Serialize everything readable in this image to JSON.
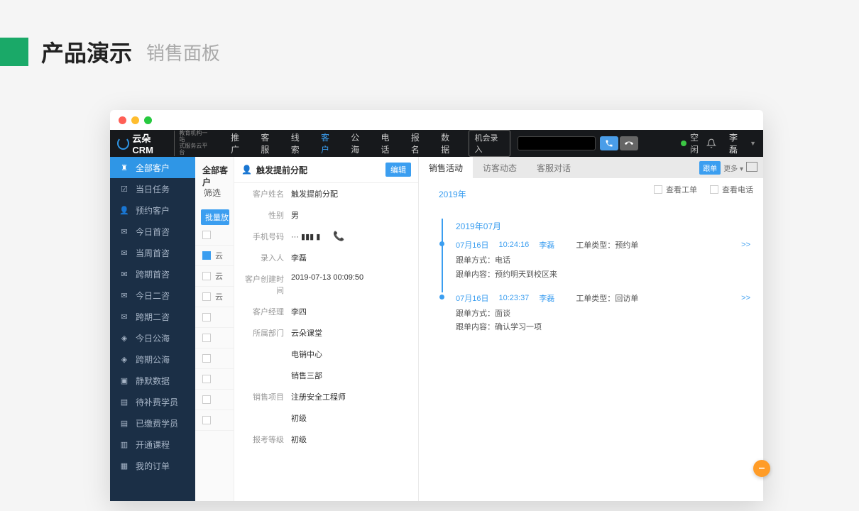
{
  "page": {
    "title": "产品演示",
    "subtitle": "销售面板"
  },
  "topbar": {
    "logo_text": "云朵CRM",
    "logo_sub1": "教育机构一站",
    "logo_sub2": "式服务云平台",
    "nav": [
      "推广",
      "客服",
      "线索",
      "客户",
      "公海",
      "电话",
      "报名",
      "数据"
    ],
    "nav_active_index": 3,
    "entry_button": "机会录入",
    "status_label": "空闲",
    "user": "李磊"
  },
  "sidebar": {
    "items": [
      {
        "label": "全部客户",
        "icon": "user"
      },
      {
        "label": "当日任务",
        "icon": "check"
      },
      {
        "label": "预约客户",
        "icon": "user"
      },
      {
        "label": "今日首咨",
        "icon": "chat"
      },
      {
        "label": "当周首咨",
        "icon": "chat"
      },
      {
        "label": "跨期首咨",
        "icon": "chat"
      },
      {
        "label": "今日二咨",
        "icon": "chat"
      },
      {
        "label": "跨期二咨",
        "icon": "chat"
      },
      {
        "label": "今日公海",
        "icon": "sea"
      },
      {
        "label": "跨期公海",
        "icon": "sea"
      },
      {
        "label": "静默数据",
        "icon": "data"
      },
      {
        "label": "待补费学员",
        "icon": "money"
      },
      {
        "label": "已缴费学员",
        "icon": "money"
      },
      {
        "label": "开通课程",
        "icon": "book"
      },
      {
        "label": "我的订单",
        "icon": "order"
      }
    ],
    "active_index": 0
  },
  "midcol": {
    "header": "全部客户",
    "filter": "筛选",
    "batch": "批量放",
    "rows": [
      {
        "text": "",
        "sel": false
      },
      {
        "text": "云",
        "sel": true
      },
      {
        "text": "云",
        "sel": false
      },
      {
        "text": "云",
        "sel": false
      },
      {
        "text": "",
        "sel": false
      },
      {
        "text": "",
        "sel": false
      },
      {
        "text": "",
        "sel": false
      },
      {
        "text": "",
        "sel": false
      },
      {
        "text": "",
        "sel": false
      },
      {
        "text": "",
        "sel": false
      }
    ]
  },
  "detail": {
    "title": "触发提前分配",
    "edit_label": "编辑",
    "fields": [
      {
        "label": "客户姓名",
        "value": "触发提前分配"
      },
      {
        "label": "性别",
        "value": "男"
      },
      {
        "label": "手机号码",
        "value": "··· ▮▮▮ ▮",
        "phone": true
      },
      {
        "label": "录入人",
        "value": "李磊"
      },
      {
        "label": "客户创建时间",
        "value": "2019-07-13 00:09:50"
      },
      {
        "label": "客户经理",
        "value": "李四"
      },
      {
        "label": "所属部门",
        "value": "云朵课堂"
      },
      {
        "label": "",
        "value": "电销中心"
      },
      {
        "label": "",
        "value": "销售三部"
      },
      {
        "label": "销售项目",
        "value": "注册安全工程师"
      },
      {
        "label": "",
        "value": "初级"
      },
      {
        "label": "报考等级",
        "value": "初级"
      }
    ]
  },
  "activity": {
    "tabs": [
      "销售活动",
      "访客动态",
      "客服对话"
    ],
    "active_tab": 0,
    "tag_btn": "跟单",
    "more_btn": "更多 ▾",
    "filter1": "查看工单",
    "filter2": "查看电话",
    "year": "2019年",
    "month": "2019年07月",
    "events": [
      {
        "date": "07月16日",
        "time": "10:24:16",
        "person": "李磊",
        "type_label": "工单类型：",
        "type_value": "预约单",
        "method_label": "跟单方式：",
        "method_value": "电话",
        "content_label": "跟单内容：",
        "content_value": "预约明天到校区来"
      },
      {
        "date": "07月16日",
        "time": "10:23:37",
        "person": "李磊",
        "type_label": "工单类型：",
        "type_value": "回访单",
        "method_label": "跟单方式：",
        "method_value": "面谈",
        "content_label": "跟单内容：",
        "content_value": "确认学习一项"
      }
    ],
    "expand": ">>"
  },
  "float_btn": "–"
}
